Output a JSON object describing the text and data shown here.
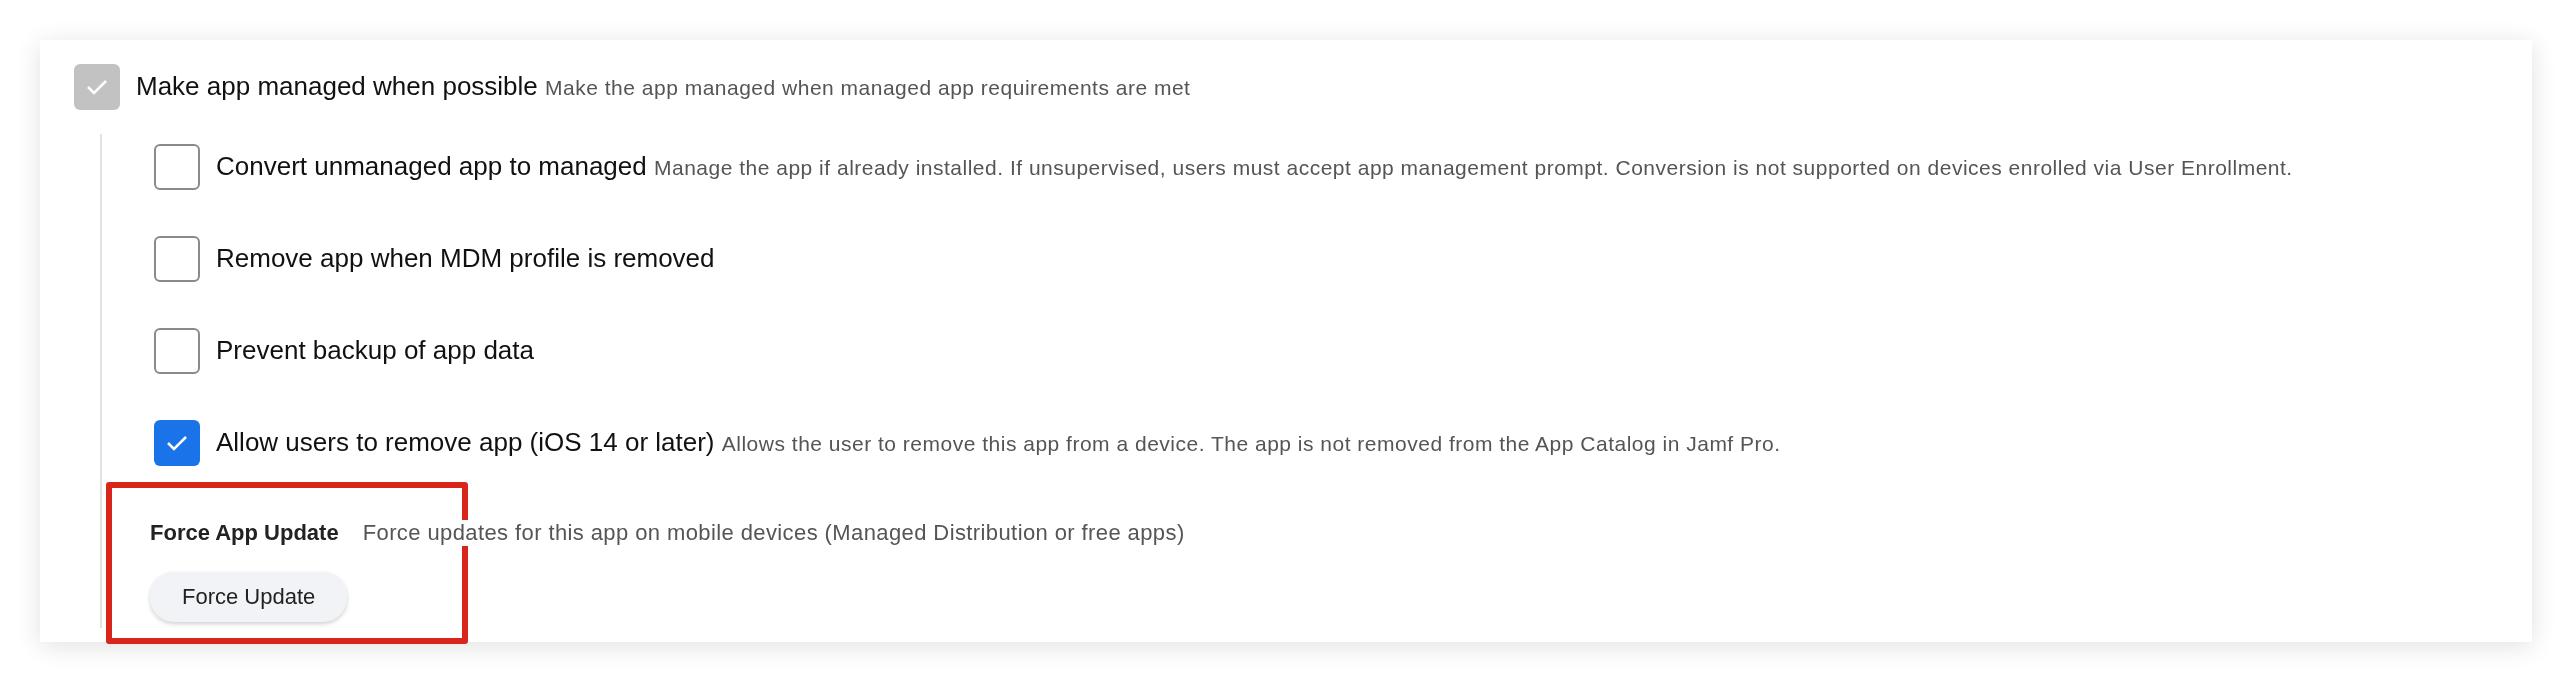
{
  "main_option": {
    "label": "Make app managed when possible",
    "description": "Make the app managed when managed app requirements are met",
    "checked": true,
    "disabled": true
  },
  "sub_options": [
    {
      "label": "Convert unmanaged app to managed",
      "description": "Manage the app if already installed. If unsupervised, users must accept app management prompt. Conversion is not supported on devices enrolled via User Enrollment.",
      "checked": false
    },
    {
      "label": "Remove app when MDM profile is removed",
      "checked": false
    },
    {
      "label": "Prevent backup of app data",
      "checked": false
    },
    {
      "label": "Allow users to remove app (iOS 14 or later)",
      "description": "Allows the user to remove this app from a device. The app is not removed from the App Catalog in Jamf Pro.",
      "checked": true
    }
  ],
  "force_update": {
    "title": "Force App Update",
    "description": "Force updates for this app on mobile devices (Managed Distribution or free apps)",
    "button": "Force Update",
    "highlighted": true
  }
}
